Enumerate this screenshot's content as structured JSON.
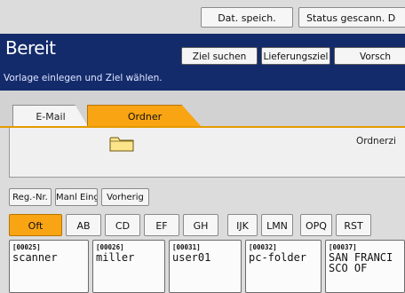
{
  "toolbar": {
    "save_label": "Dat. speich.",
    "status_label": "Status gescann. D"
  },
  "header": {
    "title": "Bereit",
    "subtitle": "Vorlage einlegen und Ziel wählen.",
    "search_label": "Ziel suchen",
    "history_label": "Lieferungsziel",
    "preview_label": "Vorsch"
  },
  "tabs": [
    {
      "label": "E-Mail",
      "selected": false
    },
    {
      "label": "Ordner",
      "selected": true
    }
  ],
  "folder_panel": {
    "text": "Ordnerzi",
    "icon": "folder-icon"
  },
  "nav_buttons": [
    "Reg.-Nr.",
    "Manl Eing.",
    "Vorherig"
  ],
  "index_tabs": [
    {
      "label": "Oft",
      "selected": true
    },
    {
      "label": "AB",
      "selected": false
    },
    {
      "label": "CD",
      "selected": false
    },
    {
      "label": "EF",
      "selected": false
    },
    {
      "label": "GH",
      "selected": false
    },
    {
      "label": "IJK",
      "selected": false
    },
    {
      "label": "LMN",
      "selected": false
    },
    {
      "label": "OPQ",
      "selected": false
    },
    {
      "label": "RST",
      "selected": false
    }
  ],
  "destinations": [
    {
      "number": "[00025]",
      "name": "scanner"
    },
    {
      "number": "[00026]",
      "name": "miller"
    },
    {
      "number": "[00031]",
      "name": "user01"
    },
    {
      "number": "[00032]",
      "name": "pc-folder"
    },
    {
      "number": "[00037]",
      "name": "SAN FRANCI\nSCO OF"
    }
  ],
  "colors": {
    "header_bg": "#142b6b",
    "accent_orange": "#f9a412"
  }
}
